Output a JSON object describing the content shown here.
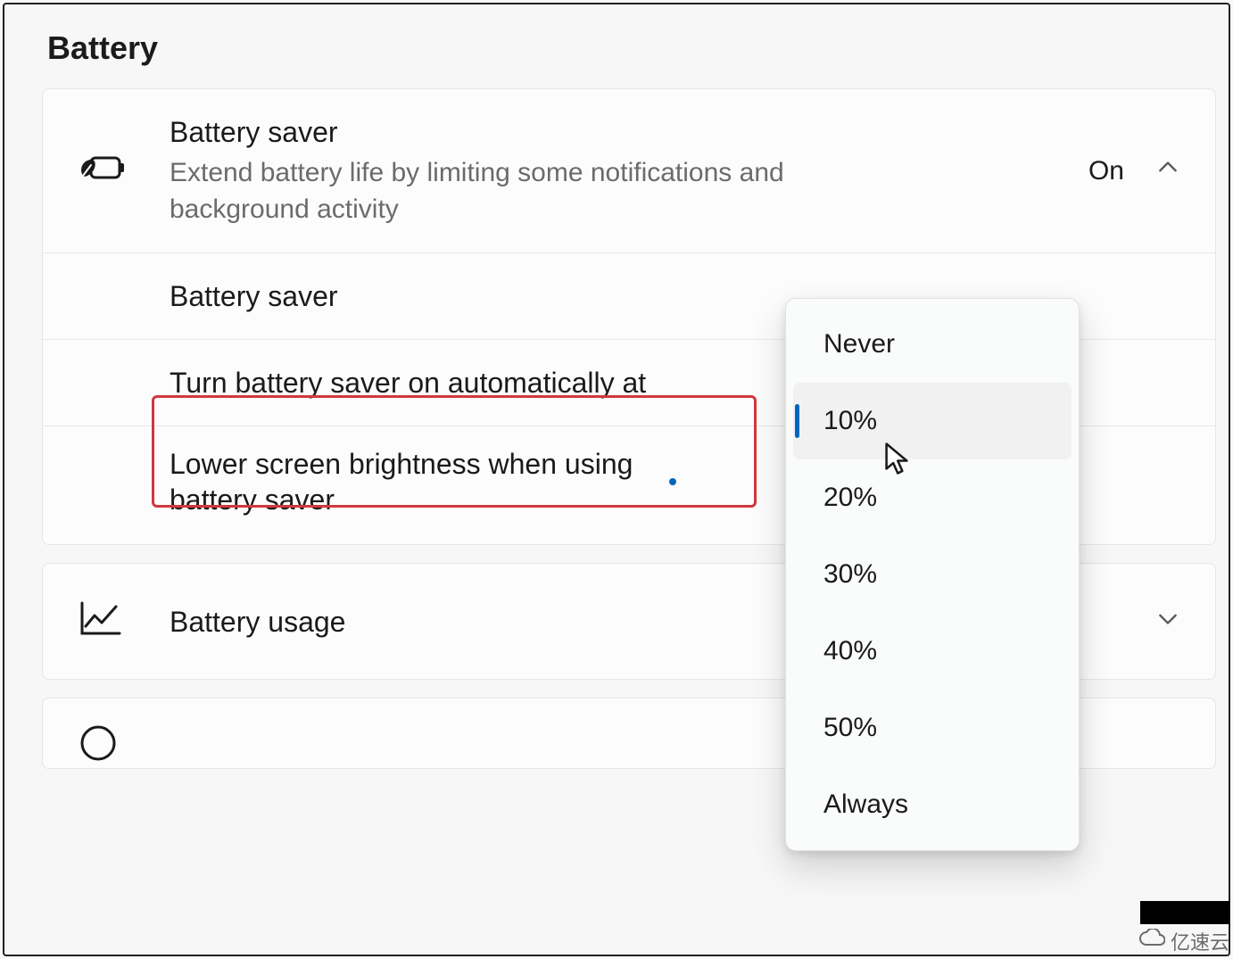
{
  "section_title": "Battery",
  "battery_saver": {
    "title": "Battery saver",
    "description": "Extend battery life by limiting some notifications and background activity",
    "status": "On",
    "sub": {
      "toggle_label": "Battery saver",
      "auto_on_label": "Turn battery saver on automatically at",
      "brightness_label": "Lower screen brightness when using battery saver"
    }
  },
  "battery_usage": {
    "title": "Battery usage"
  },
  "dropdown": {
    "options": [
      "Never",
      "10%",
      "20%",
      "30%",
      "40%",
      "50%",
      "Always"
    ],
    "selected_index": 1
  },
  "watermark": {
    "text": "亿速云"
  }
}
